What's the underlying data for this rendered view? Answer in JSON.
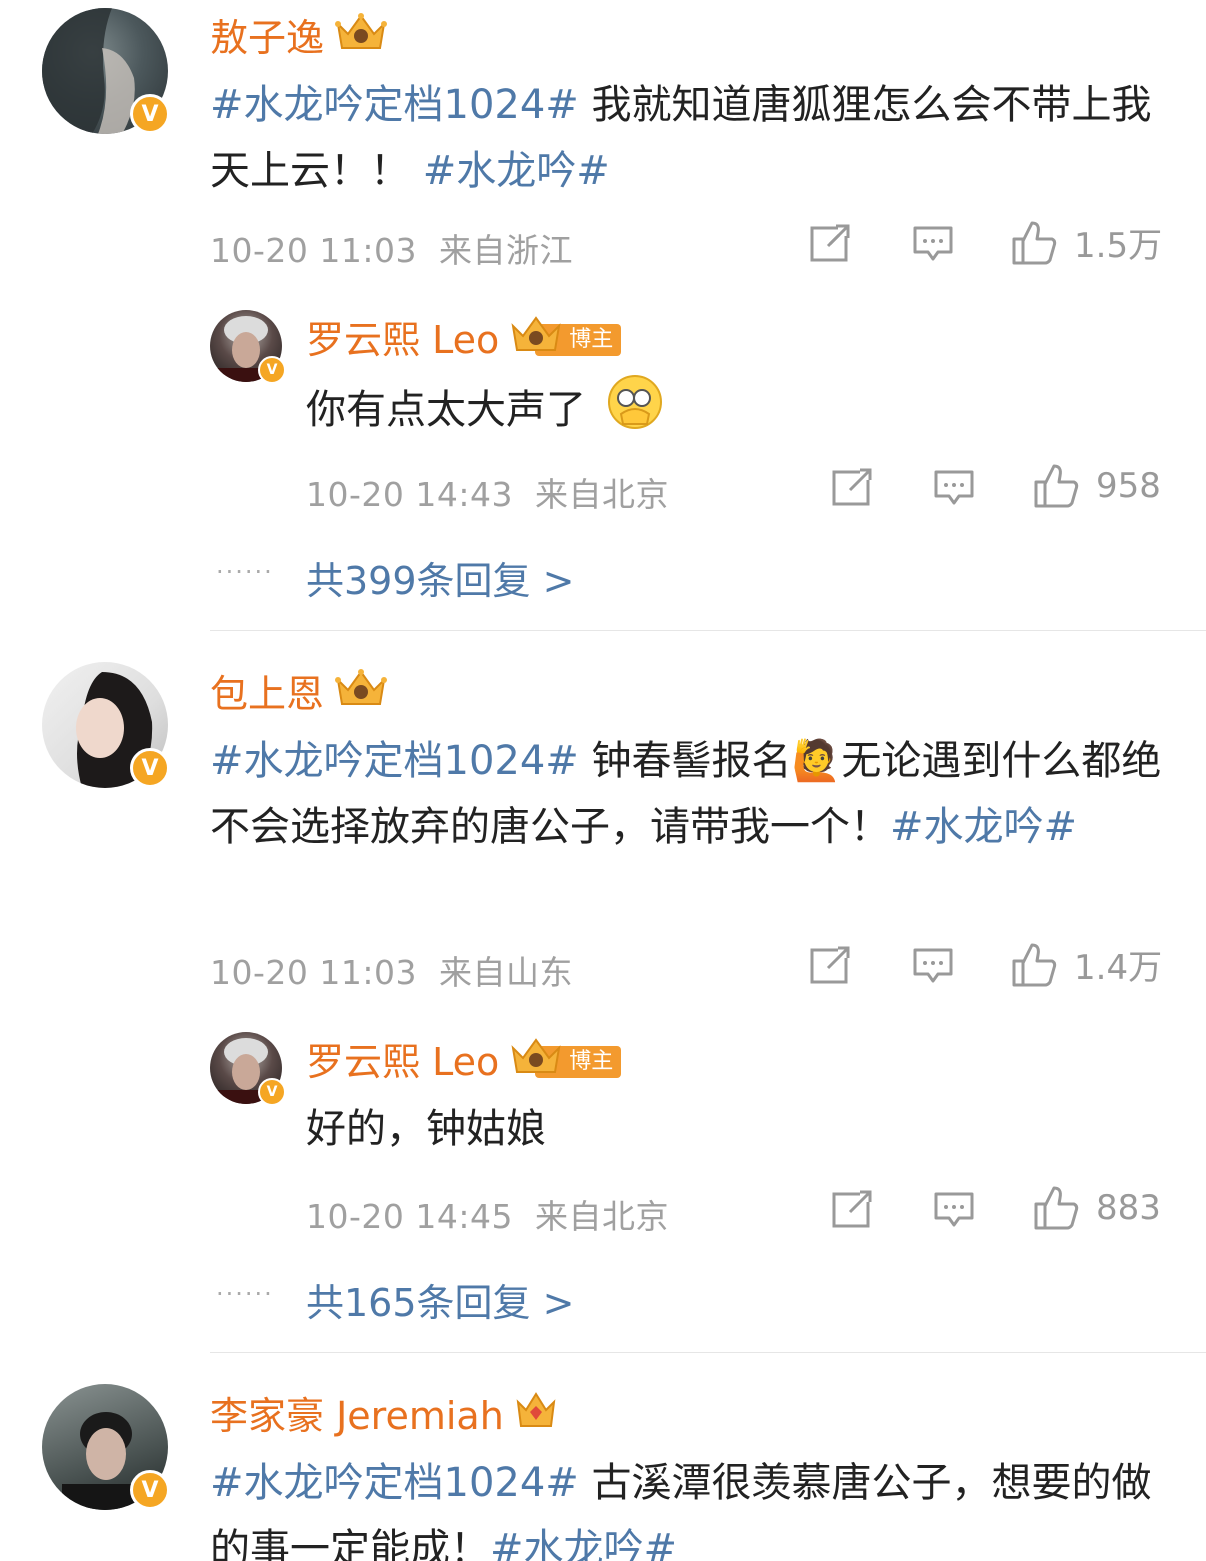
{
  "colors": {
    "username": "#e8711f",
    "topic": "#4f79a8",
    "meta": "#a0a0a0",
    "vbadge": "#f5a623"
  },
  "comments": [
    {
      "user": "敖子逸",
      "text_parts": [
        {
          "t": "#水龙吟定档1024#",
          "topic": true
        },
        {
          "t": " 我就知道唐狐狸怎么会不带上我天上云！！ ",
          "topic": false
        },
        {
          "t": "#水龙吟#",
          "topic": true
        }
      ],
      "time": "10-20 11:03",
      "location": "来自浙江",
      "likes": "1.5万",
      "reply": {
        "user": "罗云熙 Leo",
        "badge": "博主",
        "text": "你有点太大声了",
        "emoji": "facepalm-emoji",
        "time": "10-20 14:43",
        "location": "来自北京",
        "likes": "958"
      },
      "more_replies": "共399条回复 >"
    },
    {
      "user": "包上恩",
      "text_parts": [
        {
          "t": "#水龙吟定档1024#",
          "topic": true
        },
        {
          "t": " 钟春髻报名",
          "topic": false
        },
        {
          "t": "🙋",
          "topic": false
        },
        {
          "t": "无论遇到什么都绝不会选择放弃的唐公子，请带我一个！",
          "topic": false
        },
        {
          "t": "#水龙吟#",
          "topic": true
        }
      ],
      "time": "10-20 11:03",
      "location": "来自山东",
      "likes": "1.4万",
      "reply": {
        "user": "罗云熙 Leo",
        "badge": "博主",
        "text": "好的，钟姑娘",
        "time": "10-20 14:45",
        "location": "来自北京",
        "likes": "883"
      },
      "more_replies": "共165条回复 >"
    },
    {
      "user": "李家豪 Jeremiah",
      "text_parts": [
        {
          "t": "#水龙吟定档1024#",
          "topic": true
        },
        {
          "t": " 古溪潭很羡慕唐公子，想要的做的事一定能成！",
          "topic": false
        },
        {
          "t": "#水龙吟#",
          "topic": true
        }
      ]
    }
  ],
  "icons": {
    "share": "share-icon",
    "comment": "comment-icon",
    "like": "like-icon",
    "verified": "verified-badge-icon",
    "crown": "crown-icon",
    "more": "ellipsis-icon"
  }
}
